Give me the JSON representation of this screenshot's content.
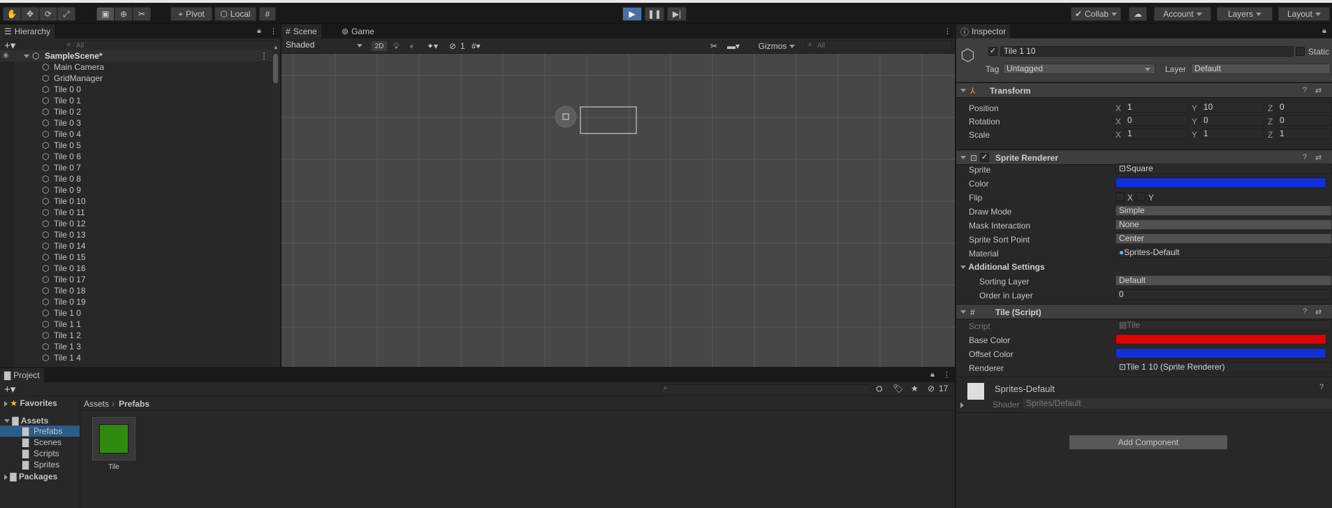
{
  "toolbar": {
    "pivot_label": "Pivot",
    "local_label": "Local",
    "collab_label": "Collab",
    "account_label": "Account",
    "layers_label": "Layers",
    "layout_label": "Layout"
  },
  "hierarchy": {
    "tab_label": "Hierarchy",
    "search_placeholder": "All",
    "scene_name": "SampleScene*",
    "items": [
      "Main Camera",
      "GridManager",
      "Tile 0 0",
      "Tile 0 1",
      "Tile 0 2",
      "Tile 0 3",
      "Tile 0 4",
      "Tile 0 5",
      "Tile 0 6",
      "Tile 0 7",
      "Tile 0 8",
      "Tile 0 9",
      "Tile 0 10",
      "Tile 0 11",
      "Tile 0 12",
      "Tile 0 13",
      "Tile 0 14",
      "Tile 0 15",
      "Tile 0 16",
      "Tile 0 17",
      "Tile 0 18",
      "Tile 0 19",
      "Tile 1 0",
      "Tile 1 1",
      "Tile 1 2",
      "Tile 1 3",
      "Tile 1 4"
    ]
  },
  "scene_view": {
    "tabs": [
      "Scene",
      "Game"
    ],
    "shading_mode": "Shaded",
    "mode_2d": "2D",
    "hidden_count": "1",
    "gizmos_label": "Gizmos",
    "search_placeholder": "All"
  },
  "project": {
    "tab_label": "Project",
    "breadcrumb": [
      "Assets",
      "Prefabs"
    ],
    "hidden_count": "17",
    "tree": {
      "favorites": "Favorites",
      "assets": "Assets",
      "folders": [
        "Prefabs",
        "Scenes",
        "Scripts",
        "Sprites"
      ],
      "packages": "Packages"
    },
    "asset_name": "Tile",
    "asset_color": "#2f8a0f"
  },
  "inspector": {
    "tab_label": "Inspector",
    "object_name": "Tile 1 10",
    "static_label": "Static",
    "tag_label": "Tag",
    "tag_value": "Untagged",
    "layer_label": "Layer",
    "layer_value": "Default",
    "transform": {
      "title": "Transform",
      "rows": [
        {
          "label": "Position",
          "x": "1",
          "y": "10",
          "z": "0"
        },
        {
          "label": "Rotation",
          "x": "0",
          "y": "0",
          "z": "0"
        },
        {
          "label": "Scale",
          "x": "1",
          "y": "1",
          "z": "1"
        }
      ]
    },
    "sprite_renderer": {
      "title": "Sprite Renderer",
      "sprite_label": "Sprite",
      "sprite_value": "Square",
      "color_label": "Color",
      "color_value": "#1030d8",
      "flip_label": "Flip",
      "flip_x": "X",
      "flip_y": "Y",
      "draw_mode_label": "Draw Mode",
      "draw_mode_value": "Simple",
      "mask_label": "Mask Interaction",
      "mask_value": "None",
      "sort_point_label": "Sprite Sort Point",
      "sort_point_value": "Center",
      "material_label": "Material",
      "material_value": "Sprites-Default",
      "additional_title": "Additional Settings",
      "sorting_layer_label": "Sorting Layer",
      "sorting_layer_value": "Default",
      "order_label": "Order in Layer",
      "order_value": "0"
    },
    "tile_script": {
      "title": "Tile (Script)",
      "script_label": "Script",
      "script_value": "Tile",
      "base_color_label": "Base Color",
      "base_color_value": "#e00000",
      "offset_color_label": "Offset Color",
      "offset_color_value": "#1030d8",
      "renderer_label": "Renderer",
      "renderer_value": "Tile 1 10 (Sprite Renderer)"
    },
    "material": {
      "name": "Sprites-Default",
      "shader_label": "Shader",
      "shader_value": "Sprites/Default"
    },
    "add_component_label": "Add Component"
  }
}
